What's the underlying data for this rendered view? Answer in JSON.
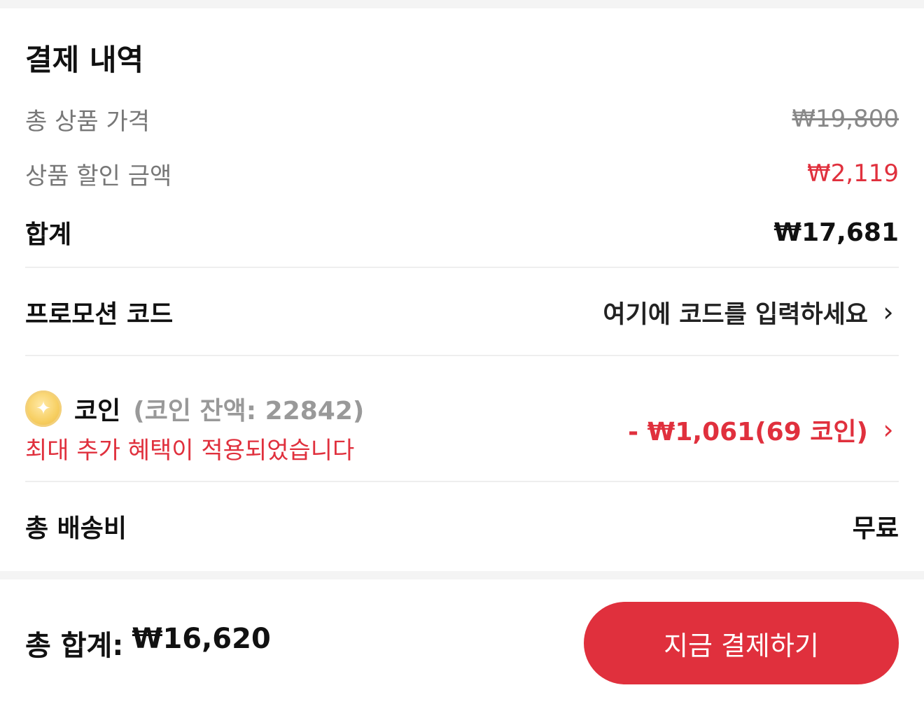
{
  "summary": {
    "title": "결제 내역",
    "total_product_price": {
      "label": "총 상품 가격",
      "value": "₩19,800"
    },
    "product_discount": {
      "label": "상품 할인 금액",
      "value": "₩2,119"
    },
    "subtotal": {
      "label": "합계",
      "value": "₩17,681"
    }
  },
  "promo": {
    "label": "프로모션 코드",
    "placeholder": "여기에 코드를 입력하세요",
    "chevron": "›"
  },
  "coin": {
    "icon": "coin-sparkle-icon",
    "icon_glyph": "✦",
    "name": "코인",
    "balance": "(코인 잔액: 22842)",
    "note": "최대 추가 혜택이 적용되었습니다",
    "discount": "- ₩1,061(69 코인)",
    "chevron": "›"
  },
  "shipping": {
    "label": "총 배송비",
    "value": "무료"
  },
  "footer": {
    "total_label": "총 합계:",
    "total_value": "₩16,620",
    "pay_button": "지금 결제하기"
  },
  "colors": {
    "accent": "#e0303d",
    "muted": "#777777",
    "divider": "#eeeeee"
  }
}
